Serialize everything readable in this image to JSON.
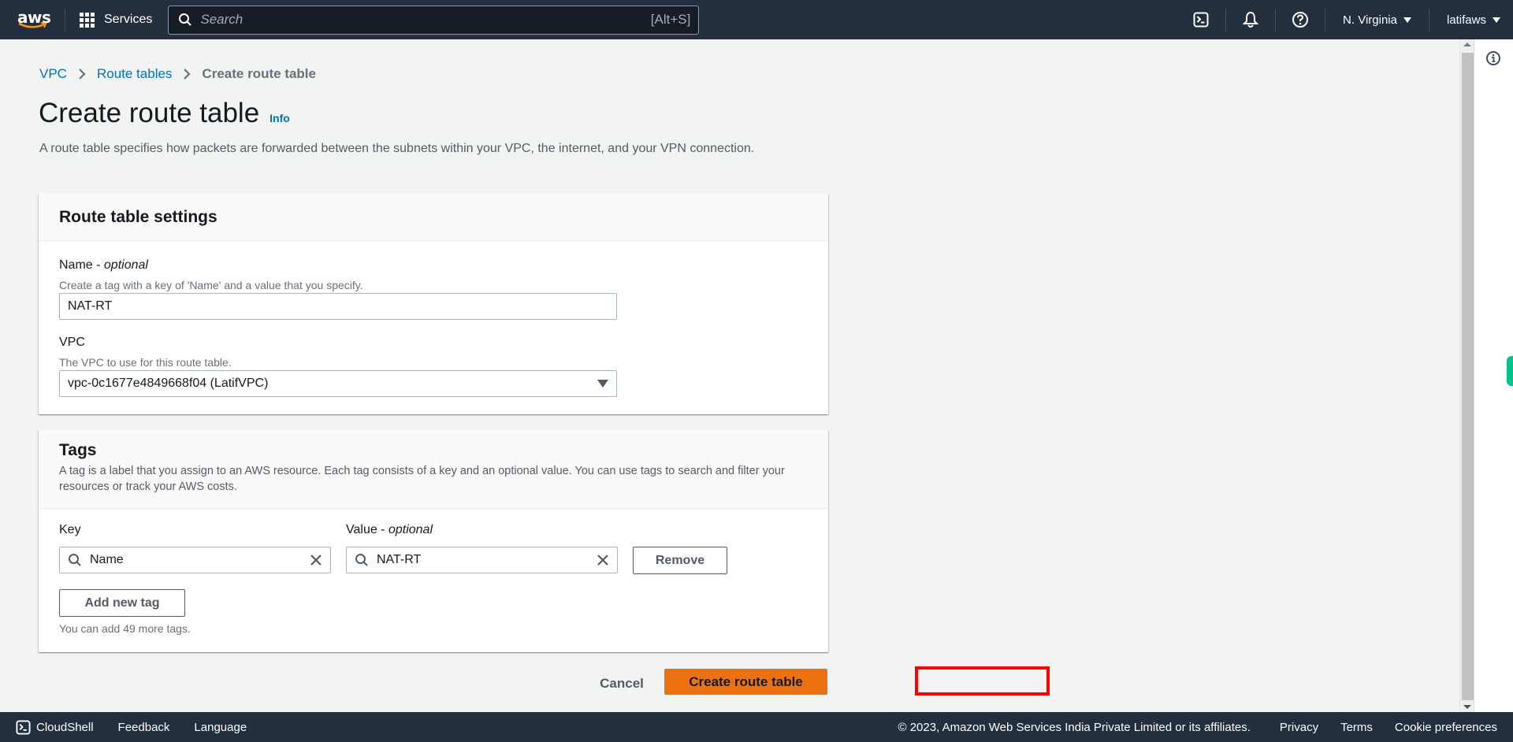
{
  "topnav": {
    "logo_text": "aws",
    "services_label": "Services",
    "search_placeholder": "Search",
    "search_shortcut": "[Alt+S]",
    "region": "N. Virginia",
    "account": "latifaws"
  },
  "breadcrumb": {
    "items": [
      "VPC",
      "Route tables"
    ],
    "current": "Create route table"
  },
  "page": {
    "title": "Create route table",
    "info_link": "Info",
    "description": "A route table specifies how packets are forwarded between the subnets within your VPC, the internet, and your VPN connection."
  },
  "settings": {
    "title": "Route table settings",
    "name_label": "Name - ",
    "name_label_optional": "optional",
    "name_hint": "Create a tag with a key of 'Name' and a value that you specify.",
    "name_value": "NAT-RT",
    "vpc_label": "VPC",
    "vpc_hint": "The VPC to use for this route table.",
    "vpc_selected": "vpc-0c1677e4849668f04 (LatifVPC)"
  },
  "tags": {
    "title": "Tags",
    "description": "A tag is a label that you assign to an AWS resource. Each tag consists of a key and an optional value. You can use tags to search and filter your resources or track your AWS costs.",
    "key_label": "Key",
    "value_label": "Value - ",
    "value_label_optional": "optional",
    "rows": [
      {
        "key": "Name",
        "value": "NAT-RT"
      }
    ],
    "remove_label": "Remove",
    "add_label": "Add new tag",
    "remaining_text": "You can add 49 more tags."
  },
  "actions": {
    "cancel_label": "Cancel",
    "create_label": "Create route table"
  },
  "footer": {
    "cloudshell": "CloudShell",
    "feedback": "Feedback",
    "language": "Language",
    "copyright": "© 2023, Amazon Web Services India Private Limited or its affiliates.",
    "privacy": "Privacy",
    "terms": "Terms",
    "cookies": "Cookie preferences"
  },
  "colors": {
    "nav_bg": "#232f3e",
    "link": "#0073bb",
    "primary_button": "#ec7211",
    "highlight_box": "#ff0000",
    "side_tab": "#00c48c"
  }
}
